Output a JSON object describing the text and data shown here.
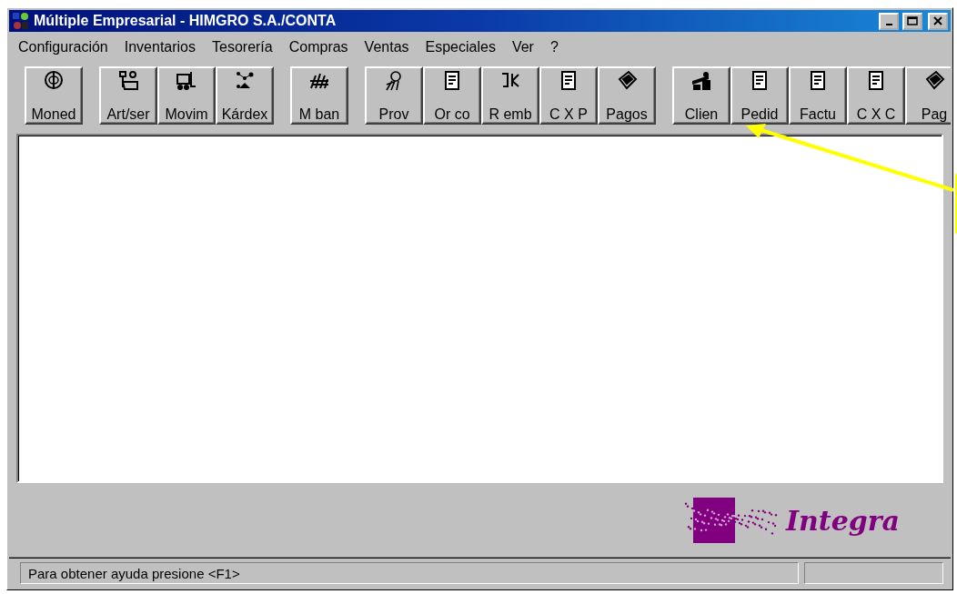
{
  "window": {
    "title": "Múltiple Empresarial - HIMGRO S.A./CONTA"
  },
  "menu": [
    {
      "label": "Configuración"
    },
    {
      "label": "Inventarios"
    },
    {
      "label": "Tesorería"
    },
    {
      "label": "Compras"
    },
    {
      "label": "Ventas"
    },
    {
      "label": "Especiales"
    },
    {
      "label": "Ver"
    },
    {
      "label": "?"
    }
  ],
  "toolbar": [
    [
      "Moned"
    ],
    [
      "Art/ser",
      "Movim",
      "Kárdex"
    ],
    [
      "M ban"
    ],
    [
      "Prov",
      "Or co",
      "R emb",
      "C X P",
      "Pagos"
    ],
    [
      "Clien",
      "Pedid",
      "Factu",
      "C X C",
      "Pag"
    ]
  ],
  "logo": {
    "text": "Integra"
  },
  "status_bar": {
    "message": "Para obtener ayuda presione <F1>"
  }
}
